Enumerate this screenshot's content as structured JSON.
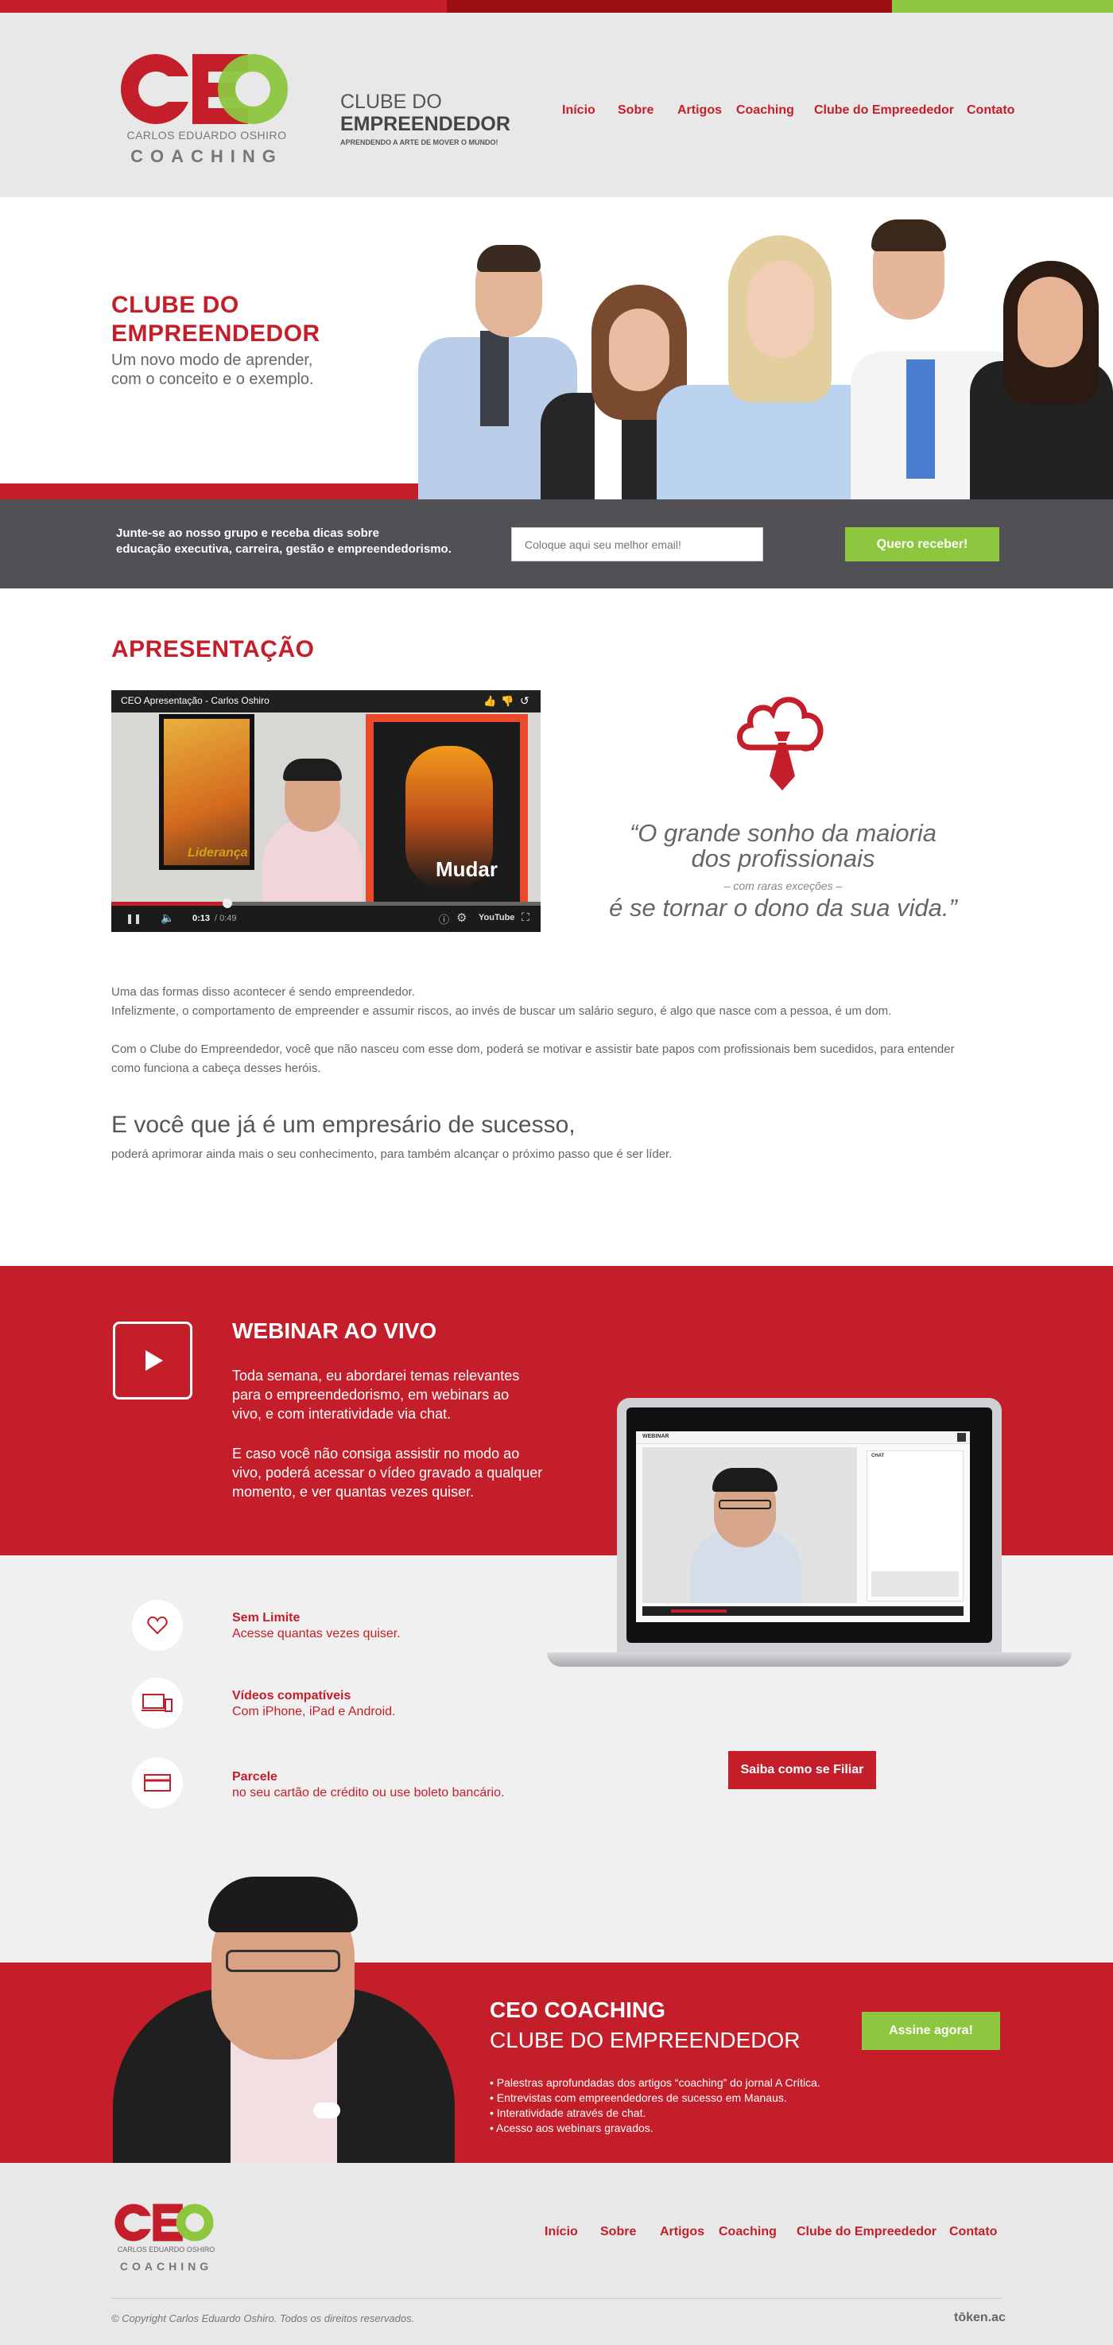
{
  "colors": {
    "red": "#c41e2a",
    "dark_red": "#9b0f12",
    "green": "#8dc63f",
    "gray_bg": "#e8e8e8",
    "dark_gray": "#505055"
  },
  "logo": {
    "letters": "CEO",
    "name": "CARLOS EDUARDO OSHIRO",
    "tagline": "COACHING"
  },
  "club": {
    "line1": "CLUBE DO",
    "line2": "EMPREENDEDOR",
    "slogan": "APRENDENDO A ARTE DE MOVER O MUNDO!"
  },
  "nav": [
    "Início",
    "Sobre",
    "Artigos",
    "Coaching",
    "Clube do Empreededor",
    "Contato"
  ],
  "hero": {
    "title1": "CLUBE DO",
    "title2": "EMPREENDEDOR",
    "sub1": "Um novo modo de aprender,",
    "sub2": "com o conceito e o exemplo."
  },
  "subscribe": {
    "text1": "Junte-se ao nosso grupo e receba dicas sobre",
    "text2": "educação executiva, carreira, gestão e empreendedorismo.",
    "placeholder": "Coloque aqui seu melhor email!",
    "button": "Quero receber!"
  },
  "presentation": {
    "title": "APRESENTAÇÃO",
    "video": {
      "title": "CEO Apresentação - Carlos Oshiro",
      "time": "0:13",
      "duration": "/ 0:49",
      "poster1": "Liderança",
      "poster2": "Mudar",
      "brand": "YouTube",
      "progress": 0.27
    },
    "quote1": "“O grande sonho da maioria",
    "quote2": "dos profissionais",
    "quote3": "– com raras exceções –",
    "quote4": "é se tornar o dono da sua vida.”",
    "p1a": "Uma das formas disso acontecer é sendo empreendedor.",
    "p1b": "Infelizmente, o comportamento de empreender e assumir riscos, ao invés de buscar um salário seguro, é algo que nasce com a pessoa, é um dom.",
    "p2": "Com o Clube do Empreendedor, você que não nasceu com esse dom, poderá se motivar e assistir bate papos com profissionais bem sucedidos, para entender como funciona a cabeça desses heróis.",
    "h2": "E você que já é um empresário de sucesso,",
    "p3": "poderá aprimorar ainda mais o seu conhecimento, para também alcançar o próximo passo que é ser líder."
  },
  "webinar": {
    "title": "WEBINAR AO VIVO",
    "p1": "Toda semana, eu abordarei temas relevantes para o empreendedorismo, em webinars ao vivo, e com interatividade via chat.",
    "p2": "E caso você não consiga assistir no modo ao vivo, poderá acessar o vídeo gravado a qualquer momento, e ver quantas vezes quiser.",
    "screen_label": "WEBINAR",
    "chat_label": "CHAT"
  },
  "features": [
    {
      "icon": "heart-icon",
      "title": "Sem Limite",
      "sub": "Acesse quantas vezes quiser."
    },
    {
      "icon": "devices-icon",
      "title": "Vídeos compatíveis",
      "sub": "Com iPhone, iPad e Android."
    },
    {
      "icon": "card-icon",
      "title": "Parcele",
      "sub": "no seu cartão de crédito ou use boleto bancário."
    }
  ],
  "filiar_button": "Saiba como se Filiar",
  "cta": {
    "title": "CEO COACHING",
    "subtitle": "CLUBE DO EMPREENDEDOR",
    "button": "Assine agora!",
    "bullets": [
      "• Palestras aprofundadas dos artigos “coaching” do jornal A Crítica.",
      "• Entrevistas com empreendedores de sucesso em Manaus.",
      "• Interatividade através de chat.",
      "• Acesso aos webinars gravados."
    ]
  },
  "footer": {
    "nav": [
      "Início",
      "Sobre",
      "Artigos",
      "Coaching",
      "Clube do Empreededor",
      "Contato"
    ],
    "copyright": "© Copyright Carlos  Eduardo Oshiro. Todos os direitos reservados.",
    "credit": "tōken.ac"
  }
}
